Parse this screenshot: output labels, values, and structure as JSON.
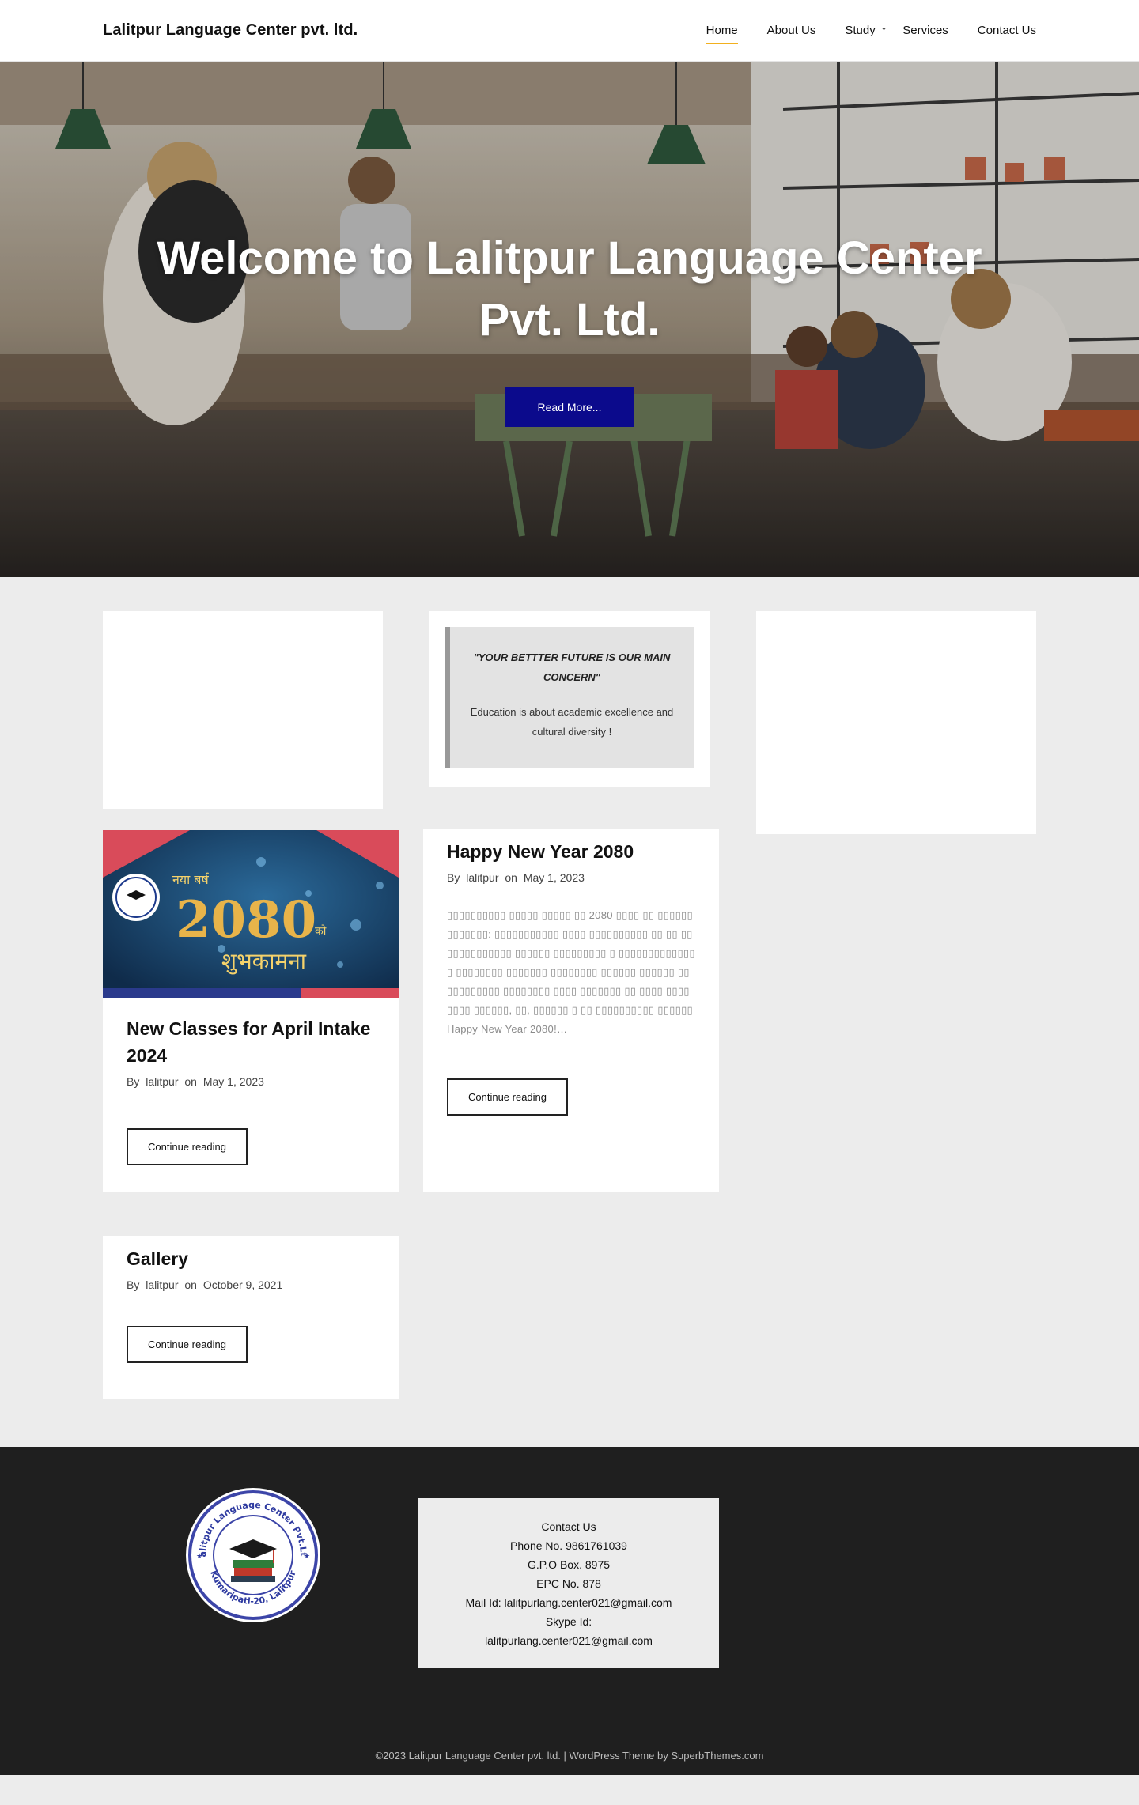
{
  "site": {
    "title": "Lalitpur Language Center pvt. ltd."
  },
  "nav": {
    "items": [
      {
        "label": "Home",
        "active": true
      },
      {
        "label": "About Us"
      },
      {
        "label": "Study",
        "has_dropdown": true
      },
      {
        "label": "Services"
      },
      {
        "label": "Contact Us"
      }
    ]
  },
  "hero": {
    "title": "Welcome to Lalitpur Language Center Pvt. Ltd.",
    "button_label": "Read More..."
  },
  "quote_widget": {
    "title": "\"YOUR BETTTER FUTURE IS OUR MAIN CONCERN\"",
    "text": "Education is about academic excellence and cultural diversity !"
  },
  "posts": [
    {
      "title": "New Classes for April Intake 2024",
      "by": "By",
      "author": "lalitpur",
      "on": "on",
      "date": "May 1, 2023",
      "image": {
        "badge_text": "नया बर्ष",
        "year_text": "2080",
        "ko_text": "को",
        "greeting_text": "शुभकामना"
      },
      "button_label": "Continue reading"
    },
    {
      "title": "Happy New Year 2080",
      "by": "By",
      "author": "lalitpur",
      "on": "on",
      "date": "May 1, 2023",
      "excerpt": "▯▯▯▯▯▯▯▯▯▯ ▯▯▯▯▯ ▯▯▯▯▯ ▯▯ 2080 ▯▯▯▯ ▯▯ ▯▯▯▯▯▯▯▯▯▯▯▯▯: ▯▯▯▯▯▯▯▯▯▯▯ ▯▯▯▯ ▯▯▯▯▯▯▯▯▯▯ ▯▯ ▯▯ ▯▯▯▯▯▯▯▯▯▯▯▯▯ ▯▯▯▯▯▯ ▯▯▯▯▯▯▯▯▯ ▯ ▯▯▯▯▯▯▯▯▯▯▯▯▯▯ ▯▯▯▯▯▯▯▯ ▯▯▯▯▯▯▯ ▯▯▯▯▯▯▯▯ ▯▯▯▯▯▯ ▯▯▯▯▯▯ ▯▯ ▯▯▯▯▯▯▯▯▯ ▯▯▯▯▯▯▯▯ ▯▯▯▯ ▯▯▯▯▯▯▯ ▯▯ ▯▯▯▯ ▯▯▯▯▯▯▯▯ ▯▯▯▯▯▯, ▯▯, ▯▯▯▯▯▯ ▯ ▯▯ ▯▯▯▯▯▯▯▯▯▯ ▯▯▯▯▯▯ Happy New Year 2080!…",
      "button_label": "Continue reading"
    },
    {
      "title": "Gallery",
      "by": "By",
      "author": "lalitpur",
      "on": "on",
      "date": "October 9, 2021",
      "button_label": "Continue reading"
    }
  ],
  "footer": {
    "logo": {
      "ring_text": "Lalitpur Language Center Pvt.Ltd",
      "bottom_text": "Kumaripati-20, Lalitpur"
    },
    "contact": {
      "heading": "Contact Us",
      "phone": "Phone No. 9861761039",
      "gpo": "G.P.O Box. 8975",
      "epc": "EPC No. 878",
      "mail": "Mail Id: lalitpurlang.center021@gmail.com",
      "skype_label": "Skype Id:",
      "skype": "lalitpurlang.center021@gmail.com"
    },
    "copyright": "©2023 Lalitpur Language Center pvt. ltd. | WordPress Theme by SuperbThemes.com"
  },
  "colors": {
    "hero_button": "#0b0a8c",
    "nav_active_underline": "#f2b01e",
    "footer_bg": "#1f1f1f",
    "page_bg": "#ececec"
  }
}
